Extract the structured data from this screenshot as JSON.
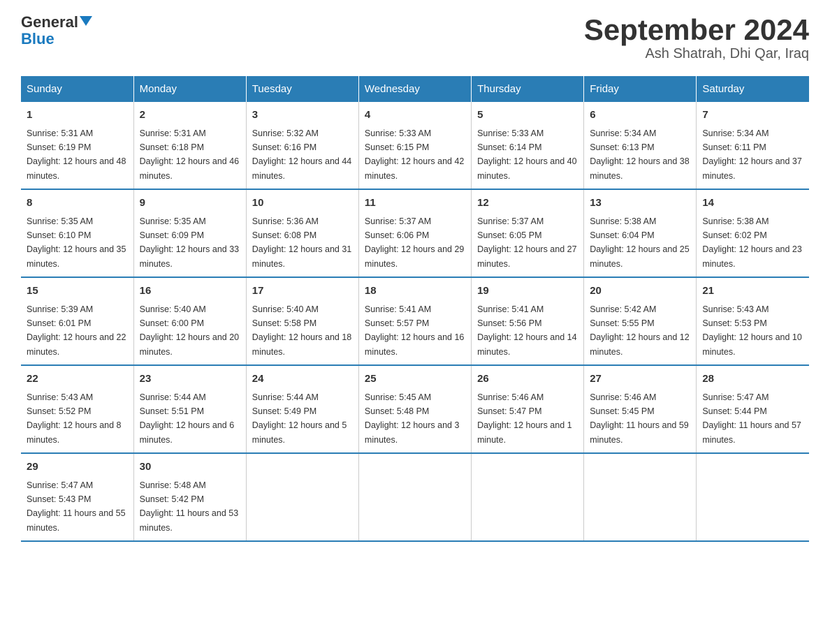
{
  "logo": {
    "general": "General",
    "blue": "Blue",
    "triangle": "▲"
  },
  "title": "September 2024",
  "subtitle": "Ash Shatrah, Dhi Qar, Iraq",
  "days_of_week": [
    "Sunday",
    "Monday",
    "Tuesday",
    "Wednesday",
    "Thursday",
    "Friday",
    "Saturday"
  ],
  "weeks": [
    [
      {
        "day": "1",
        "sunrise": "Sunrise: 5:31 AM",
        "sunset": "Sunset: 6:19 PM",
        "daylight": "Daylight: 12 hours and 48 minutes."
      },
      {
        "day": "2",
        "sunrise": "Sunrise: 5:31 AM",
        "sunset": "Sunset: 6:18 PM",
        "daylight": "Daylight: 12 hours and 46 minutes."
      },
      {
        "day": "3",
        "sunrise": "Sunrise: 5:32 AM",
        "sunset": "Sunset: 6:16 PM",
        "daylight": "Daylight: 12 hours and 44 minutes."
      },
      {
        "day": "4",
        "sunrise": "Sunrise: 5:33 AM",
        "sunset": "Sunset: 6:15 PM",
        "daylight": "Daylight: 12 hours and 42 minutes."
      },
      {
        "day": "5",
        "sunrise": "Sunrise: 5:33 AM",
        "sunset": "Sunset: 6:14 PM",
        "daylight": "Daylight: 12 hours and 40 minutes."
      },
      {
        "day": "6",
        "sunrise": "Sunrise: 5:34 AM",
        "sunset": "Sunset: 6:13 PM",
        "daylight": "Daylight: 12 hours and 38 minutes."
      },
      {
        "day": "7",
        "sunrise": "Sunrise: 5:34 AM",
        "sunset": "Sunset: 6:11 PM",
        "daylight": "Daylight: 12 hours and 37 minutes."
      }
    ],
    [
      {
        "day": "8",
        "sunrise": "Sunrise: 5:35 AM",
        "sunset": "Sunset: 6:10 PM",
        "daylight": "Daylight: 12 hours and 35 minutes."
      },
      {
        "day": "9",
        "sunrise": "Sunrise: 5:35 AM",
        "sunset": "Sunset: 6:09 PM",
        "daylight": "Daylight: 12 hours and 33 minutes."
      },
      {
        "day": "10",
        "sunrise": "Sunrise: 5:36 AM",
        "sunset": "Sunset: 6:08 PM",
        "daylight": "Daylight: 12 hours and 31 minutes."
      },
      {
        "day": "11",
        "sunrise": "Sunrise: 5:37 AM",
        "sunset": "Sunset: 6:06 PM",
        "daylight": "Daylight: 12 hours and 29 minutes."
      },
      {
        "day": "12",
        "sunrise": "Sunrise: 5:37 AM",
        "sunset": "Sunset: 6:05 PM",
        "daylight": "Daylight: 12 hours and 27 minutes."
      },
      {
        "day": "13",
        "sunrise": "Sunrise: 5:38 AM",
        "sunset": "Sunset: 6:04 PM",
        "daylight": "Daylight: 12 hours and 25 minutes."
      },
      {
        "day": "14",
        "sunrise": "Sunrise: 5:38 AM",
        "sunset": "Sunset: 6:02 PM",
        "daylight": "Daylight: 12 hours and 23 minutes."
      }
    ],
    [
      {
        "day": "15",
        "sunrise": "Sunrise: 5:39 AM",
        "sunset": "Sunset: 6:01 PM",
        "daylight": "Daylight: 12 hours and 22 minutes."
      },
      {
        "day": "16",
        "sunrise": "Sunrise: 5:40 AM",
        "sunset": "Sunset: 6:00 PM",
        "daylight": "Daylight: 12 hours and 20 minutes."
      },
      {
        "day": "17",
        "sunrise": "Sunrise: 5:40 AM",
        "sunset": "Sunset: 5:58 PM",
        "daylight": "Daylight: 12 hours and 18 minutes."
      },
      {
        "day": "18",
        "sunrise": "Sunrise: 5:41 AM",
        "sunset": "Sunset: 5:57 PM",
        "daylight": "Daylight: 12 hours and 16 minutes."
      },
      {
        "day": "19",
        "sunrise": "Sunrise: 5:41 AM",
        "sunset": "Sunset: 5:56 PM",
        "daylight": "Daylight: 12 hours and 14 minutes."
      },
      {
        "day": "20",
        "sunrise": "Sunrise: 5:42 AM",
        "sunset": "Sunset: 5:55 PM",
        "daylight": "Daylight: 12 hours and 12 minutes."
      },
      {
        "day": "21",
        "sunrise": "Sunrise: 5:43 AM",
        "sunset": "Sunset: 5:53 PM",
        "daylight": "Daylight: 12 hours and 10 minutes."
      }
    ],
    [
      {
        "day": "22",
        "sunrise": "Sunrise: 5:43 AM",
        "sunset": "Sunset: 5:52 PM",
        "daylight": "Daylight: 12 hours and 8 minutes."
      },
      {
        "day": "23",
        "sunrise": "Sunrise: 5:44 AM",
        "sunset": "Sunset: 5:51 PM",
        "daylight": "Daylight: 12 hours and 6 minutes."
      },
      {
        "day": "24",
        "sunrise": "Sunrise: 5:44 AM",
        "sunset": "Sunset: 5:49 PM",
        "daylight": "Daylight: 12 hours and 5 minutes."
      },
      {
        "day": "25",
        "sunrise": "Sunrise: 5:45 AM",
        "sunset": "Sunset: 5:48 PM",
        "daylight": "Daylight: 12 hours and 3 minutes."
      },
      {
        "day": "26",
        "sunrise": "Sunrise: 5:46 AM",
        "sunset": "Sunset: 5:47 PM",
        "daylight": "Daylight: 12 hours and 1 minute."
      },
      {
        "day": "27",
        "sunrise": "Sunrise: 5:46 AM",
        "sunset": "Sunset: 5:45 PM",
        "daylight": "Daylight: 11 hours and 59 minutes."
      },
      {
        "day": "28",
        "sunrise": "Sunrise: 5:47 AM",
        "sunset": "Sunset: 5:44 PM",
        "daylight": "Daylight: 11 hours and 57 minutes."
      }
    ],
    [
      {
        "day": "29",
        "sunrise": "Sunrise: 5:47 AM",
        "sunset": "Sunset: 5:43 PM",
        "daylight": "Daylight: 11 hours and 55 minutes."
      },
      {
        "day": "30",
        "sunrise": "Sunrise: 5:48 AM",
        "sunset": "Sunset: 5:42 PM",
        "daylight": "Daylight: 11 hours and 53 minutes."
      },
      null,
      null,
      null,
      null,
      null
    ]
  ]
}
